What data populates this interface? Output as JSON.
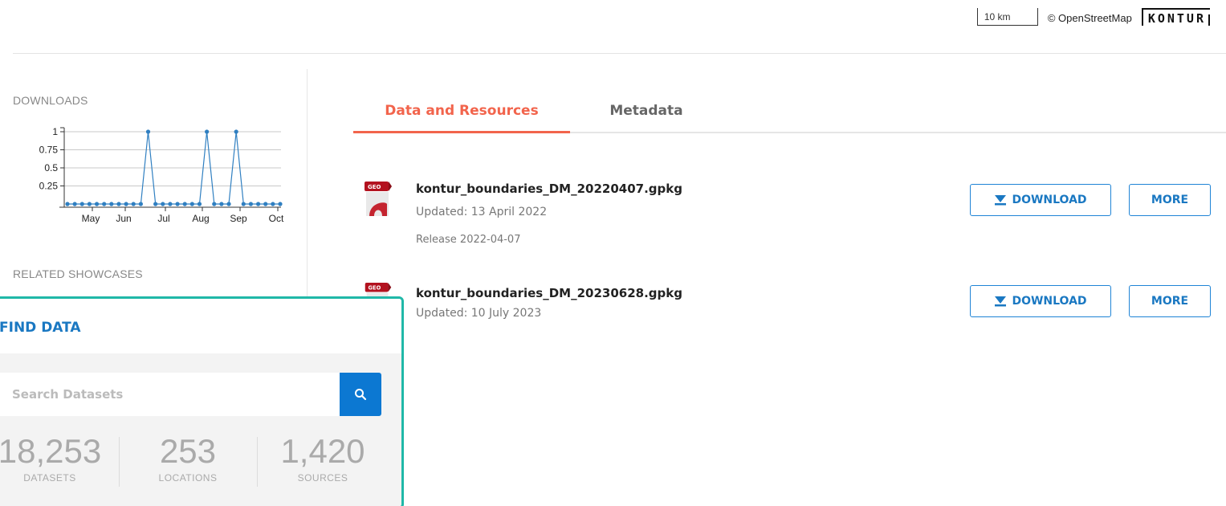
{
  "map": {
    "scale_label": "10 km",
    "attribution": "© OpenStreetMap",
    "logo_text": "KONTUR"
  },
  "sidebar": {
    "downloads_label": "DOWNLOADS",
    "related_label": "RELATED SHOWCASES"
  },
  "chart_data": {
    "type": "line",
    "title": "",
    "xlabel": "",
    "ylabel": "",
    "ylim": [
      0,
      1
    ],
    "yticks": [
      "0.25",
      "0.5",
      "0.75",
      "1"
    ],
    "xticks": [
      "May",
      "Jun",
      "Jul",
      "Aug",
      "Sep",
      "Oct"
    ],
    "grid": true,
    "series": [
      {
        "values": [
          0,
          0,
          0,
          0,
          0,
          0,
          0,
          0,
          0,
          0,
          0,
          1,
          0,
          0,
          0,
          0,
          0,
          0,
          0,
          1,
          0,
          0,
          0,
          1,
          0,
          0,
          0,
          0,
          0,
          0
        ]
      }
    ]
  },
  "tabs": {
    "active": "Data and Resources",
    "other": "Metadata"
  },
  "resources": [
    {
      "icon_text": "GEO",
      "name": "kontur_boundaries_DM_20220407.gpkg",
      "updated": "Updated: 13 April 2022",
      "description": "Release 2022-04-07",
      "download_label": "DOWNLOAD",
      "more_label": "MORE"
    },
    {
      "icon_text": "GEO",
      "name": "kontur_boundaries_DM_20230628.gpkg",
      "updated": "Updated: 10 July 2023",
      "download_label": "DOWNLOAD",
      "more_label": "MORE"
    }
  ],
  "find_data": {
    "title": "FIND DATA",
    "search_placeholder": "Search Datasets",
    "stats": [
      {
        "value": "18,253",
        "label": "DATASETS"
      },
      {
        "value": "253",
        "label": "LOCATIONS"
      },
      {
        "value": "1,420",
        "label": "SOURCES"
      }
    ]
  },
  "colors": {
    "accent": "#f2644c",
    "primary": "#1a78c2",
    "highlight_border": "#20b8a8",
    "chart_line": "#2f7fc1"
  }
}
